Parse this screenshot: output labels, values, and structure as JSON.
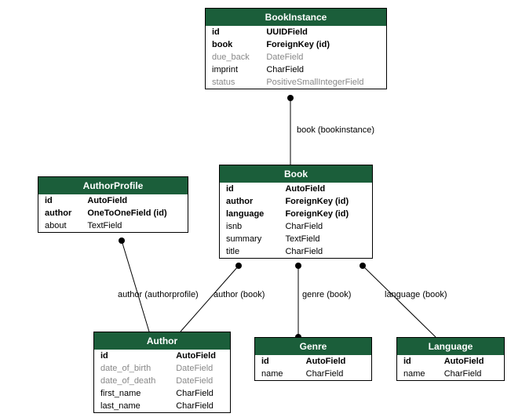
{
  "entities": {
    "bookinstance": {
      "title": "BookInstance",
      "fields": [
        {
          "name": "id",
          "type": "UUIDField",
          "style": "bold"
        },
        {
          "name": "book",
          "type": "ForeignKey (id)",
          "style": "bold"
        },
        {
          "name": "due_back",
          "type": "DateField",
          "style": "gray"
        },
        {
          "name": "imprint",
          "type": "CharField",
          "style": "normal"
        },
        {
          "name": "status",
          "type": "PositiveSmallIntegerField",
          "style": "gray"
        }
      ]
    },
    "authorprofile": {
      "title": "AuthorProfile",
      "fields": [
        {
          "name": "id",
          "type": "AutoField",
          "style": "bold"
        },
        {
          "name": "author",
          "type": "OneToOneField (id)",
          "style": "bold"
        },
        {
          "name": "about",
          "type": "TextField",
          "style": "normal"
        }
      ]
    },
    "book": {
      "title": "Book",
      "fields": [
        {
          "name": "id",
          "type": "AutoField",
          "style": "bold"
        },
        {
          "name": "author",
          "type": "ForeignKey (id)",
          "style": "bold"
        },
        {
          "name": "language",
          "type": "ForeignKey (id)",
          "style": "bold"
        },
        {
          "name": "isnb",
          "type": "CharField",
          "style": "normal"
        },
        {
          "name": "summary",
          "type": "TextField",
          "style": "normal"
        },
        {
          "name": "title",
          "type": "CharField",
          "style": "normal"
        }
      ]
    },
    "author": {
      "title": "Author",
      "fields": [
        {
          "name": "id",
          "type": "AutoField",
          "style": "bold"
        },
        {
          "name": "date_of_birth",
          "type": "DateField",
          "style": "gray"
        },
        {
          "name": "date_of_death",
          "type": "DateField",
          "style": "gray"
        },
        {
          "name": "first_name",
          "type": "CharField",
          "style": "normal"
        },
        {
          "name": "last_name",
          "type": "CharField",
          "style": "normal"
        }
      ]
    },
    "genre": {
      "title": "Genre",
      "fields": [
        {
          "name": "id",
          "type": "AutoField",
          "style": "bold"
        },
        {
          "name": "name",
          "type": "CharField",
          "style": "normal"
        }
      ]
    },
    "language": {
      "title": "Language",
      "fields": [
        {
          "name": "id",
          "type": "AutoField",
          "style": "bold"
        },
        {
          "name": "name",
          "type": "CharField",
          "style": "normal"
        }
      ]
    }
  },
  "edges": {
    "bookinstance_book": "book (bookinstance)",
    "author_authorprofile": "author (authorprofile)",
    "author_book": "author (book)",
    "genre_book": "genre (book)",
    "language_book": "language (book)"
  }
}
